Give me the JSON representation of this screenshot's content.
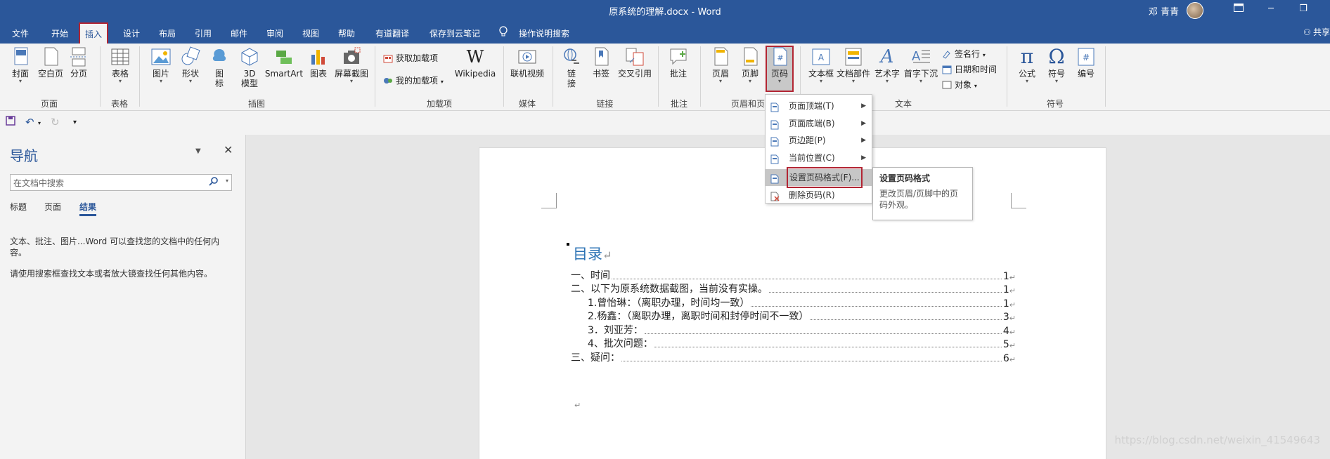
{
  "window": {
    "title": "原系统的理解.docx  -  Word",
    "user": "邓 青青",
    "btn_ribbon_icon": "ribbon-display-icon",
    "btn_minimize": "─",
    "btn_restore": "❐"
  },
  "tabs": {
    "file": "文件",
    "home": "开始",
    "insert": "插入",
    "design": "设计",
    "layout": "布局",
    "references": "引用",
    "mailings": "邮件",
    "review": "审阅",
    "view": "视图",
    "help": "帮助",
    "youdao": "有道翻译",
    "cloudnote": "保存到云笔记",
    "tellme": "操作说明搜索",
    "share": "共享"
  },
  "ribbon": {
    "cover": "封面",
    "blank_page": "空白页",
    "page_break": "分页",
    "group_pages": "页面",
    "table": "表格",
    "group_table": "表格",
    "picture": "图片",
    "shapes": "形状",
    "icons_1": "图",
    "icons_2": "标",
    "model3d_1": "3D",
    "model3d_2": "模型",
    "smartart": "SmartArt",
    "chart": "图表",
    "screenshot": "屏幕截图",
    "group_illustrations": "插图",
    "get_addins": "获取加载项",
    "my_addins": "我的加载项",
    "wikipedia": "Wikipedia",
    "group_addins": "加载项",
    "online_video": "联机视频",
    "group_media": "媒体",
    "link_1": "链",
    "link_2": "接",
    "bookmark": "书签",
    "crossref": "交叉引用",
    "group_links": "链接",
    "comment": "批注",
    "group_comments": "批注",
    "header": "页眉",
    "footer": "页脚",
    "page_number": "页码",
    "group_header_footer": "页眉和页脚",
    "textbox": "文本框",
    "quickparts": "文档部件",
    "wordart": "艺术字",
    "dropcap": "首字下沉",
    "signature_line": "签名行",
    "datetime": "日期和时间",
    "object": "对象",
    "group_text": "文本",
    "equation": "公式",
    "symbol": "符号",
    "number": "编号",
    "group_symbols": "符号"
  },
  "navigation": {
    "title": "导航",
    "search_placeholder": "在文档中搜索",
    "tab_headings": "标题",
    "tab_pages": "页面",
    "tab_results": "结果",
    "hint1": "文本、批注、图片...Word 可以查找您的文档中的任何内容。",
    "hint2": "请使用搜索框查找文本或者放大镜查找任何其他内容。"
  },
  "document": {
    "toc_title": "目录",
    "toc": [
      {
        "text": "一、时间",
        "page": "1"
      },
      {
        "text": "二、以下为原系统数据截图，当前没有实操。",
        "page": "1"
      },
      {
        "text": "1.曾怡琳：（离职办理，时间均一致）",
        "page": "1"
      },
      {
        "text": "2.杨鑫：（离职办理，离职时间和封停时间不一致）",
        "page": "3"
      },
      {
        "text": "3．刘亚芳：",
        "page": "4"
      },
      {
        "text": "4、批次问题：",
        "page": "5"
      },
      {
        "text": "三、疑问：",
        "page": "6"
      }
    ],
    "para_mark": "↵",
    "watermark": "https://blog.csdn.net/weixin_41549643"
  },
  "dropdown": {
    "items": [
      {
        "label": "页面顶端(T)"
      },
      {
        "label": "页面底端(B)"
      },
      {
        "label": "页边距(P)"
      },
      {
        "label": "当前位置(C)"
      },
      {
        "label": "设置页码格式(F)..."
      },
      {
        "label": "删除页码(R)"
      }
    ]
  },
  "tooltip": {
    "title": "设置页码格式",
    "desc": "更改页眉/页脚中的页码外观。"
  },
  "colors": {
    "word_blue": "#2b579a",
    "highlight_red": "#b22533",
    "heading_blue": "#2e74b5"
  }
}
